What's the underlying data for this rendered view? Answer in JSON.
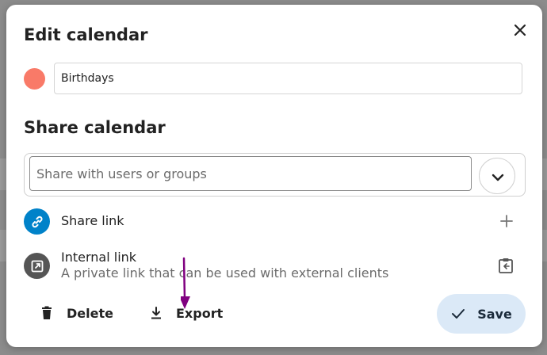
{
  "dialog": {
    "title": "Edit calendar",
    "calendar_color": "#f97a68",
    "calendar_name": "Birthdays"
  },
  "share": {
    "section_title": "Share calendar",
    "search_placeholder": "Share with users or groups",
    "share_link": {
      "label": "Share link",
      "icon_color": "#0082c9"
    },
    "internal_link": {
      "label": "Internal link",
      "description": "A private link that can be used with external clients",
      "icon_color": "#555555"
    }
  },
  "actions": {
    "delete_label": "Delete",
    "export_label": "Export",
    "save_label": "Save"
  },
  "annotation": {
    "arrow_color": "#800080"
  },
  "icons": [
    "close-icon",
    "chevron-down-icon",
    "link-icon",
    "external-link-icon",
    "plus-icon",
    "clipboard-icon",
    "trash-icon",
    "download-icon",
    "checkmark-icon"
  ]
}
